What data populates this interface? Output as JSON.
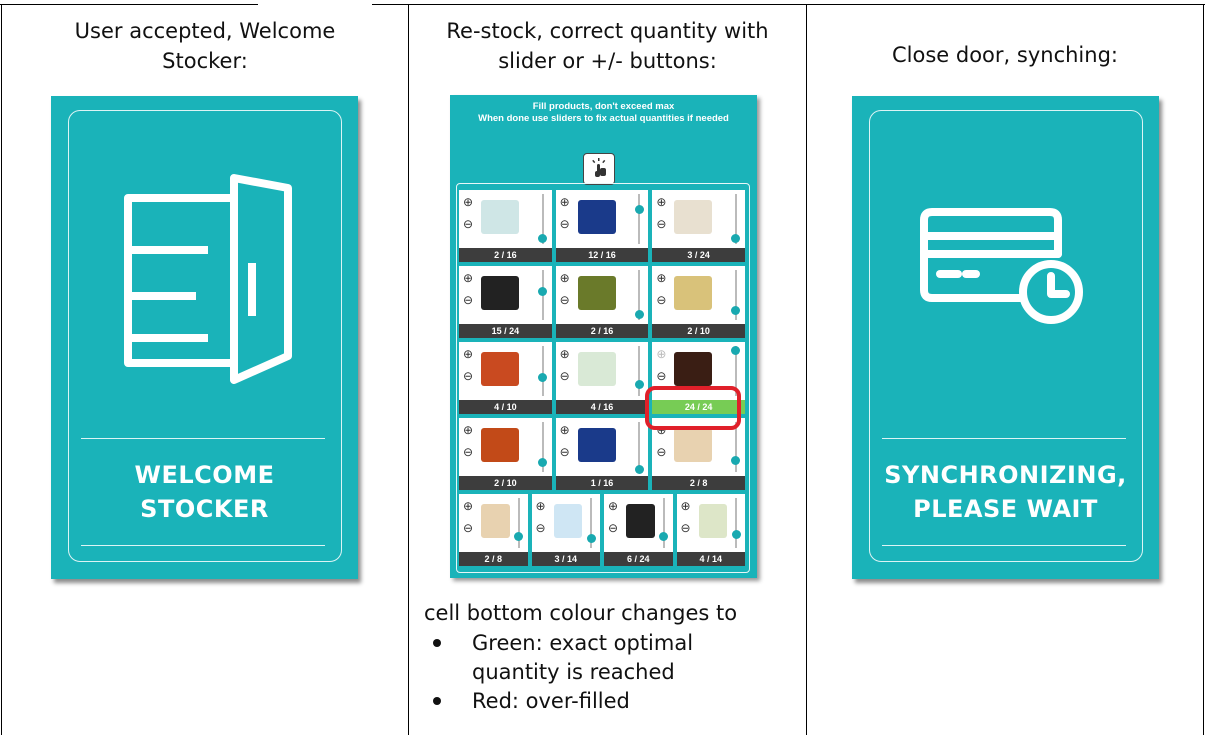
{
  "columns": [
    {
      "caption_lines": [
        "User accepted, Welcome",
        "Stocker:"
      ],
      "screen_title_lines": [
        "WELCOME",
        "STOCKER"
      ],
      "icon": "door-icon"
    },
    {
      "caption_lines": [
        "Re-stock, correct quantity with",
        "slider or +/- buttons:"
      ],
      "icon": "touch-icon"
    },
    {
      "caption_lines": [
        "Close door, synching:"
      ],
      "screen_title_lines": [
        "SYNCHRONIZING,",
        "PLEASE WAIT"
      ],
      "icon": "card-clock-icon"
    }
  ],
  "restock_screen": {
    "header_lines": [
      "Fill products, don't exceed max",
      "When done use sliders to fix actual quantities if needed"
    ],
    "plus_symbol": "⊕",
    "minus_symbol": "⊖",
    "cells": [
      {
        "qty": "2 / 16",
        "fill": 0.13,
        "status": "normal"
      },
      {
        "qty": "12 / 16",
        "fill": 0.75,
        "status": "normal"
      },
      {
        "qty": "3 / 24",
        "fill": 0.13,
        "status": "normal"
      },
      {
        "qty": "15 / 24",
        "fill": 0.63,
        "status": "normal"
      },
      {
        "qty": "2 / 16",
        "fill": 0.13,
        "status": "normal"
      },
      {
        "qty": "2 / 10",
        "fill": 0.2,
        "status": "normal"
      },
      {
        "qty": "4 / 10",
        "fill": 0.4,
        "status": "normal"
      },
      {
        "qty": "4 / 16",
        "fill": 0.25,
        "status": "normal"
      },
      {
        "qty": "24 / 24",
        "fill": 1.0,
        "status": "green"
      },
      {
        "qty": "2 / 10",
        "fill": 0.2,
        "status": "normal"
      },
      {
        "qty": "1 / 16",
        "fill": 0.06,
        "status": "normal"
      },
      {
        "qty": "2 / 8",
        "fill": 0.25,
        "status": "normal"
      },
      {
        "qty": "2 / 8",
        "fill": 0.25,
        "status": "normal"
      },
      {
        "qty": "3 / 14",
        "fill": 0.21,
        "status": "normal"
      },
      {
        "qty": "6 / 24",
        "fill": 0.25,
        "status": "normal"
      },
      {
        "qty": "4 / 14",
        "fill": 0.29,
        "status": "normal"
      }
    ],
    "colors": {
      "teal": "#1ab3b9",
      "qty_bar": "#3d3d3d",
      "green": "#77cc55",
      "highlight": "#e0202a"
    }
  },
  "notes": {
    "intro": "cell bottom colour changes to",
    "bullets": [
      "Green: exact optimal",
      "quantity is reached",
      "Red: over-filled"
    ]
  }
}
